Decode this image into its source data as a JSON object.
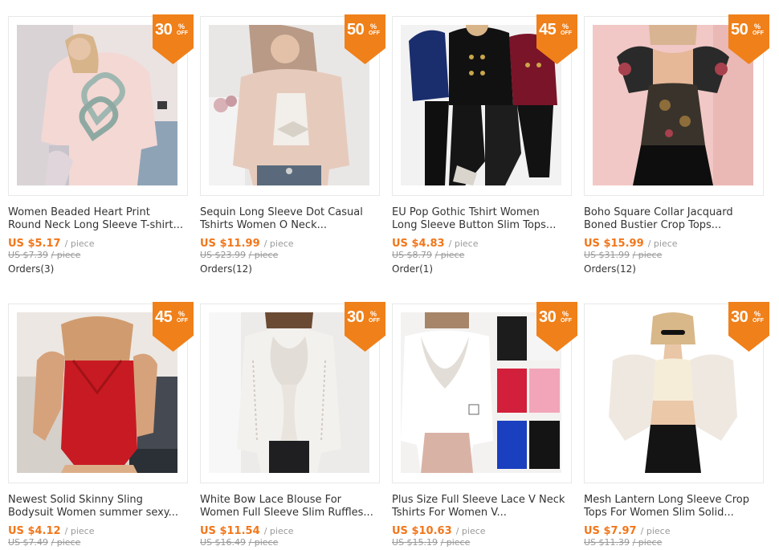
{
  "colors": {
    "accent": "#f2761a",
    "badge": "#f08019",
    "old_price": "#999999",
    "text": "#333333"
  },
  "products": [
    {
      "title_line1": "Women Beaded Heart Print",
      "title_line2": "Round Neck Long Sleeve T-shirt...",
      "price": "US $5.17",
      "unit": "/ piece",
      "old_price": "US $7.39",
      "old_unit": "/ piece",
      "orders": "Orders(3)",
      "discount": "30",
      "pct": "%",
      "off": "OFF",
      "image": "pink-heart-tshirt"
    },
    {
      "title_line1": "Sequin Long Sleeve Dot Casual",
      "title_line2": "Tshirts Women O Neck...",
      "price": "US $11.99",
      "unit": "/ piece",
      "old_price": "US $23.99",
      "old_unit": "/ piece",
      "orders": "Orders(12)",
      "discount": "50",
      "pct": "%",
      "off": "OFF",
      "image": "beige-sequin-tshirt"
    },
    {
      "title_line1": "EU Pop Gothic Tshirt Women",
      "title_line2": "Long Sleeve Button Slim Tops...",
      "price": "US $4.83",
      "unit": "/ piece",
      "old_price": "US $8.79",
      "old_unit": "/ piece",
      "orders": "Order(1)",
      "discount": "45",
      "pct": "%",
      "off": "OFF",
      "image": "gothic-button-tops"
    },
    {
      "title_line1": "Boho Square Collar Jacquard",
      "title_line2": "Boned Bustier Crop Tops...",
      "price": "US $15.99",
      "unit": "/ piece",
      "old_price": "US $31.99",
      "old_unit": "/ piece",
      "orders": "Orders(12)",
      "discount": "50",
      "pct": "%",
      "off": "OFF",
      "image": "jacquard-bustier"
    },
    {
      "title_line1": "Newest Solid Skinny Sling",
      "title_line2": "Bodysuit Women summer sexy...",
      "price": "US $4.12",
      "unit": "/ piece",
      "old_price": "US $7.49",
      "old_unit": "/ piece",
      "orders": "",
      "discount": "45",
      "pct": "%",
      "off": "OFF",
      "image": "red-bodysuit"
    },
    {
      "title_line1": "White Bow Lace Blouse For",
      "title_line2": "Women Full Sleeve Slim Ruffles...",
      "price": "US $11.54",
      "unit": "/ piece",
      "old_price": "US $16.49",
      "old_unit": "/ piece",
      "orders": "",
      "discount": "30",
      "pct": "%",
      "off": "OFF",
      "image": "white-lace-blouse"
    },
    {
      "title_line1": "Plus Size Full Sleeve Lace V Neck",
      "title_line2": "Tshirts For Women V...",
      "price": "US $10.63",
      "unit": "/ piece",
      "old_price": "US $15.19",
      "old_unit": "/ piece",
      "orders": "",
      "discount": "30",
      "pct": "%",
      "off": "OFF",
      "image": "lace-vneck-tshirts"
    },
    {
      "title_line1": "Mesh Lantern Long Sleeve Crop",
      "title_line2": "Tops For Women Slim Solid...",
      "price": "US $7.97",
      "unit": "/ piece",
      "old_price": "US $11.39",
      "old_unit": "/ piece",
      "orders": "",
      "discount": "30",
      "pct": "%",
      "off": "OFF",
      "image": "mesh-lantern-crop"
    }
  ]
}
